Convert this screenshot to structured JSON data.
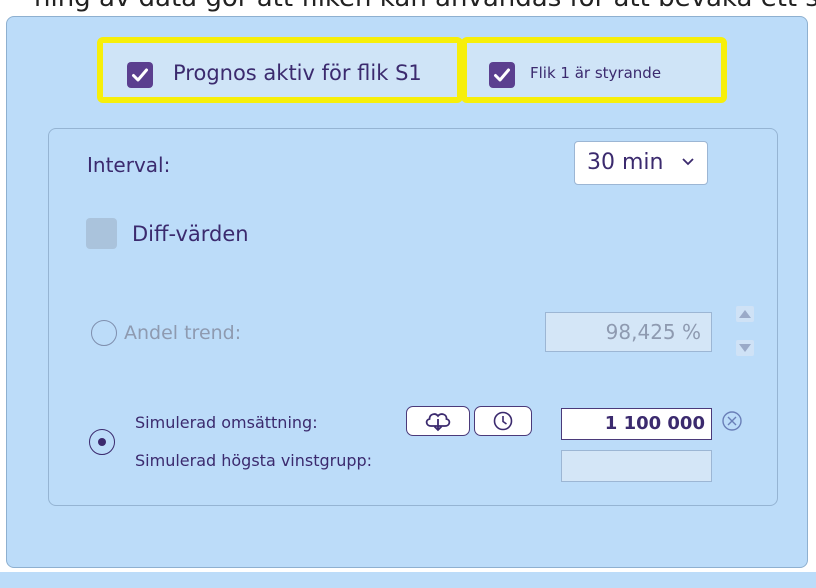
{
  "top_caption": "ning av data gör att fliken kan användas för att bevaka ett spel",
  "header_checks": [
    {
      "label": "Prognos aktiv för flik S1",
      "checked": true
    },
    {
      "label": "Flik 1 är styrande",
      "checked": true
    }
  ],
  "interval": {
    "label": "Interval:",
    "selected": "30 min"
  },
  "diff": {
    "label": "Diff-värden",
    "checked": false,
    "enabled": false
  },
  "andel_trend": {
    "label": "Andel trend:",
    "value": "98,425 %",
    "selected": false,
    "enabled": false
  },
  "simulation": {
    "selected": true,
    "omsattning_label": "Simulerad omsättning:",
    "omsattning_value": "1 100 000",
    "hogsta_label": "Simulerad högsta vinstgrupp:",
    "hogsta_value": ""
  },
  "icons": {
    "check": "check-icon",
    "chevron": "chevron-down-icon",
    "cloud_download": "cloud-download-icon",
    "clock": "clock-icon",
    "clear": "clear-circle-icon",
    "spin_up": "spin-up-icon",
    "spin_down": "spin-down-icon"
  },
  "colors": {
    "panel_bg": "#bcdcf9",
    "highlight": "#f7ef0a",
    "accent": "#5b3f8f",
    "text": "#3b2a6e",
    "disabled_text": "#8e9ab0"
  }
}
